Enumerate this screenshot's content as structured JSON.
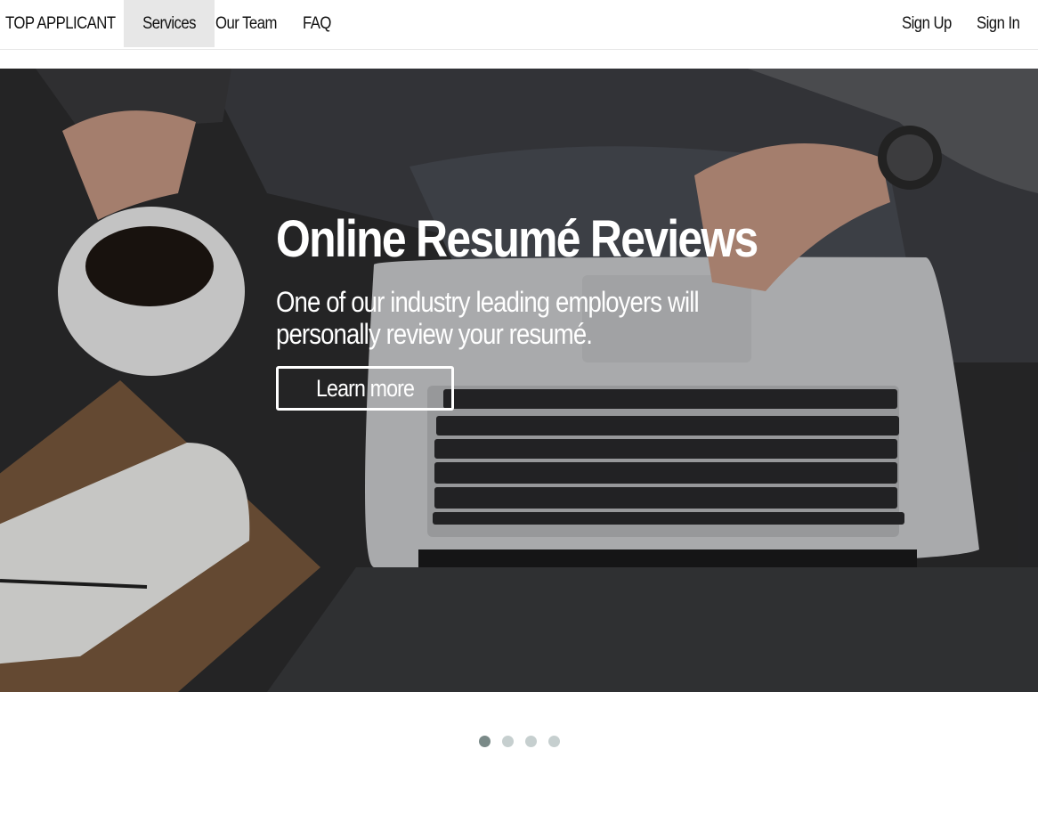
{
  "nav": {
    "brand": "TOP APPLICANT",
    "items": [
      "Services",
      "Our Team",
      "FAQ"
    ],
    "right": [
      "Sign Up",
      "Sign In"
    ],
    "active_item": "Services"
  },
  "hero": {
    "image": "desk-laptop-coffee-photo",
    "heading": "Online Resumé Reviews",
    "text": "One of our industry leading employers will personally review your resumé.",
    "button_label": "Learn more"
  },
  "carousel": {
    "slide_count": 4,
    "active_index": 0
  },
  "colors": {
    "nav_active_bg": "#e7e7e7",
    "indicator_active": "#7a8a88",
    "indicator_inactive": "#c6cfcf"
  }
}
